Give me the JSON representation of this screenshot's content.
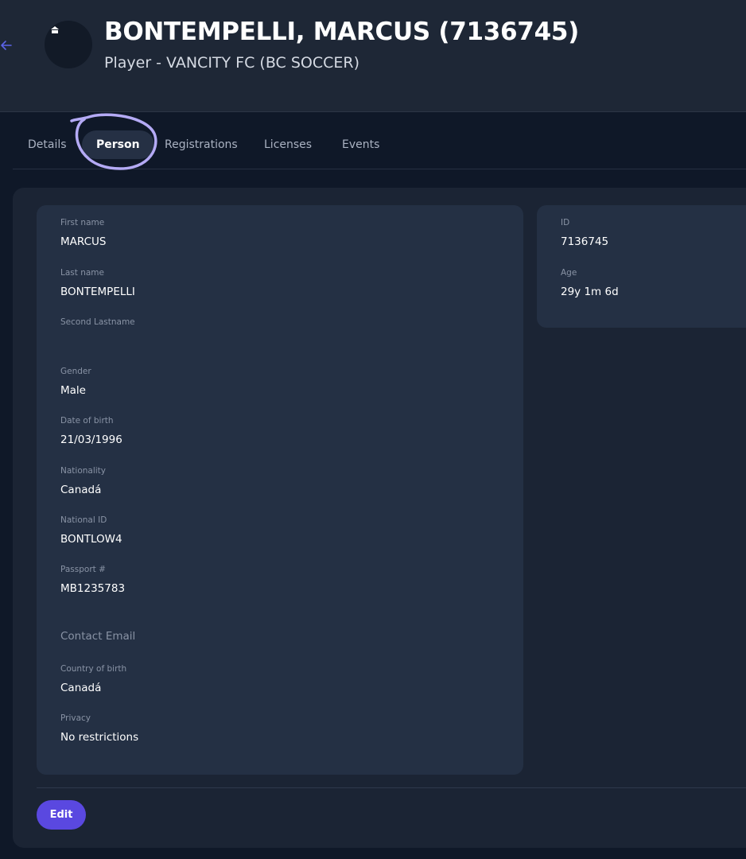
{
  "header": {
    "title": "BONTEMPELLI, MARCUS (7136745)",
    "subtitle": "Player - VANCITY FC (BC SOCCER)"
  },
  "tabs": [
    {
      "label": "Details",
      "active": false
    },
    {
      "label": "Person",
      "active": true
    },
    {
      "label": "Registrations",
      "active": false
    },
    {
      "label": "Licenses",
      "active": false
    },
    {
      "label": "Events",
      "active": false
    }
  ],
  "person": {
    "first_name": {
      "label": "First name",
      "value": "MARCUS"
    },
    "last_name": {
      "label": "Last name",
      "value": "BONTEMPELLI"
    },
    "second_lastname": {
      "label": "Second Lastname",
      "value": ""
    },
    "gender": {
      "label": "Gender",
      "value": "Male"
    },
    "date_of_birth": {
      "label": "Date of birth",
      "value": "21/03/1996"
    },
    "nationality": {
      "label": "Nationality",
      "value": "Canadá"
    },
    "national_id": {
      "label": "National ID",
      "value": "BONTLOW4"
    },
    "passport": {
      "label": "Passport #",
      "value": "MB1235783"
    },
    "contact_email": {
      "label": "Contact Email"
    },
    "country_of_birth": {
      "label": "Country of birth",
      "value": "Canadá"
    },
    "privacy": {
      "label": "Privacy",
      "value": "No restrictions"
    }
  },
  "summary": {
    "id": {
      "label": "ID",
      "value": "7136745"
    },
    "age": {
      "label": "Age",
      "value": "29y 1m 6d"
    }
  },
  "actions": {
    "edit_label": "Edit"
  },
  "colors": {
    "background": "#0f1828",
    "header_bg": "#1e2736",
    "card_bg": "#243044",
    "accent": "#5a48e0",
    "annotation": "#b4aaf5"
  }
}
